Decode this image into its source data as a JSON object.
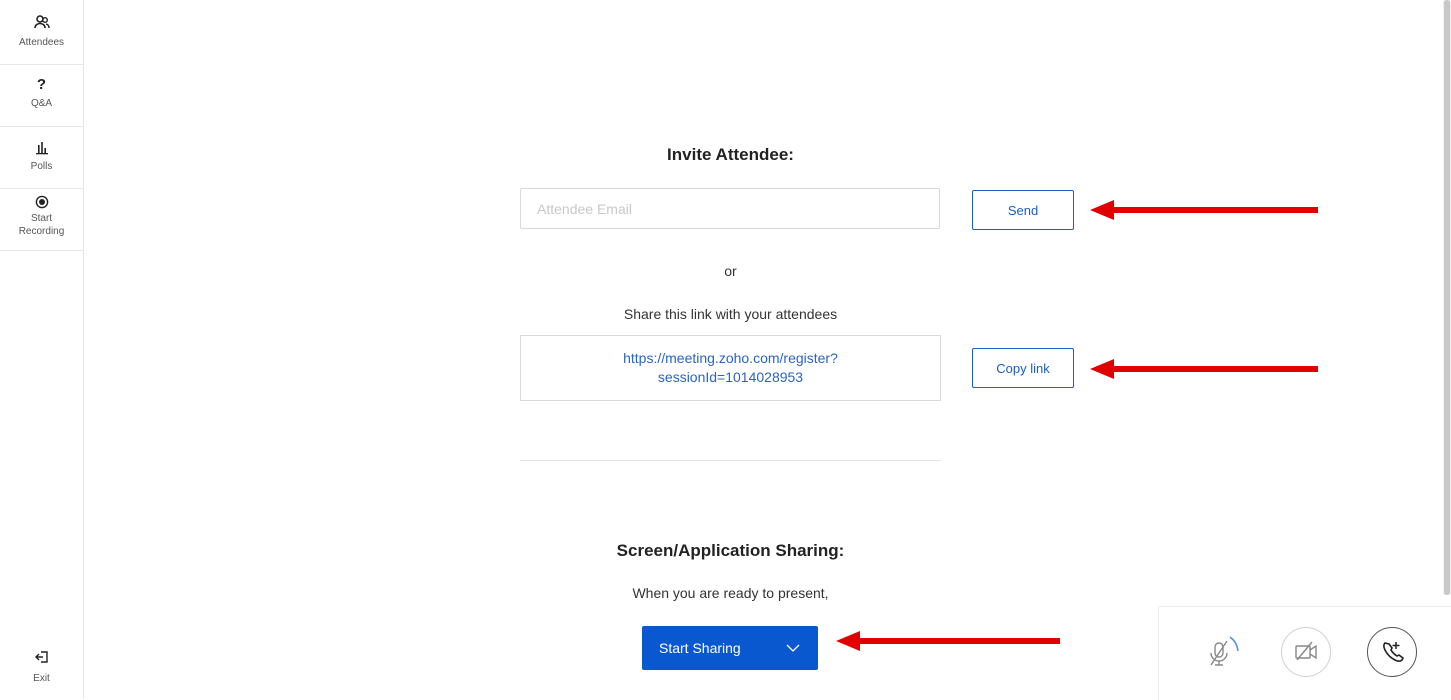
{
  "sidebar": {
    "items": [
      {
        "label": "Attendees",
        "icon": "attendees-icon"
      },
      {
        "label": "Q&A",
        "icon": "question-icon"
      },
      {
        "label": "Polls",
        "icon": "polls-icon"
      },
      {
        "label": "Start Recording",
        "label_line1": "Start",
        "label_line2": "Recording",
        "icon": "record-icon"
      }
    ],
    "exit": {
      "label": "Exit",
      "icon": "exit-icon"
    }
  },
  "invite": {
    "heading": "Invite Attendee:",
    "email_placeholder": "Attendee Email",
    "email_value": "",
    "send_label": "Send",
    "or_text": "or",
    "share_text": "Share this link with your attendees",
    "link_text": "https://meeting.zoho.com/register?sessionId=1014028953",
    "copy_label": "Copy link"
  },
  "sharing": {
    "heading": "Screen/Application Sharing:",
    "subtext": "When you are ready to present,",
    "button_label": "Start Sharing"
  },
  "controls": {
    "mic": "mic-muted-icon",
    "video": "video-off-icon",
    "call": "phone-call-icon"
  },
  "colors": {
    "accent": "#0a58d0",
    "link": "#2a64c5",
    "annotation_arrow": "#e00000"
  }
}
